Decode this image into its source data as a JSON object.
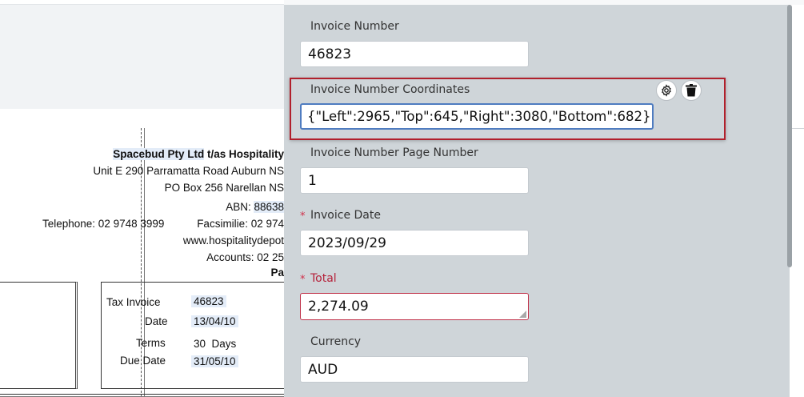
{
  "document": {
    "company": "Spacebud Pty Ltd",
    "company_suffix": " t/as Hospitality",
    "address_line": "Unit E 290 Parramatta Road Auburn NS",
    "po_box": "PO Box 256 Narellan NS",
    "abn_label": "ABN: ",
    "abn_value": "88638",
    "telephone": "Telephone: 02 9748 3999",
    "fax": "Facsimilie: 02 974",
    "website": "www.hospitalitydepot",
    "accounts": "Accounts: 02 25",
    "pa": "Pa",
    "rows": [
      {
        "label": "Tax Invoice",
        "value": "46823"
      },
      {
        "label": "Date",
        "value": "13/04/10"
      },
      {
        "label": "Terms",
        "value": "30  Days"
      },
      {
        "label": "Due Date",
        "value": "31/05/10"
      }
    ]
  },
  "form": {
    "invoice_number": {
      "label": "Invoice Number",
      "value": "46823"
    },
    "coordinates": {
      "label": "Invoice Number Coordinates",
      "value": "{\"Left\":2965,\"Top\":645,\"Right\":3080,\"Bottom\":682}"
    },
    "page_number": {
      "label": "Invoice Number Page Number",
      "value": "1"
    },
    "invoice_date": {
      "label": "Invoice Date",
      "value": "2023/09/29",
      "required_mark": "*"
    },
    "total": {
      "label": "Total",
      "value": "2,274.09",
      "required_mark": "*"
    },
    "currency": {
      "label": "Currency",
      "value": "AUD"
    }
  },
  "icons": {
    "settings": "gear-icon",
    "delete": "trash-icon"
  },
  "colors": {
    "panel_bg": "#cfd5d9",
    "highlight_border": "#b1202c",
    "required": "#d0304a",
    "focus_border": "#4f7cc0"
  }
}
